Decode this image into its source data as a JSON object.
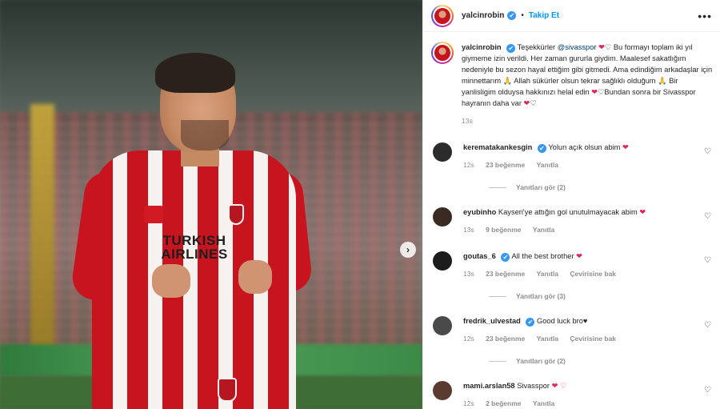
{
  "photo": {
    "sponsor_text": "TURKISH AIRLINES",
    "next_icon": "chevron-right-icon",
    "next_symbol": "›"
  },
  "header": {
    "username": "yalcinrobin",
    "verified_symbol": "✔",
    "separator": "•",
    "follow_label": "Takip Et",
    "more_symbol": "•••"
  },
  "caption": {
    "username": "yalcinrobin",
    "text_a": "Teşekkürler",
    "mention": "@sivasspor",
    "text_b": "Bu formayı toplam iki yıl giymeme izin verildi. Her zaman gururla giydim. Maalesef sakatlığım nedeniyle bu sezon hayal ettiğim gibi gitmedi. Ama edindiğim arkadaşlar için minnettarım 🙏 Allah sükürler olsun tekrar sağlıklı olduğum 🙏 Bir yanlisligim olduysa hakkınızı helal edin",
    "text_c": "Bundan sonra bir Sivasspor hayranın daha var",
    "time": "13s"
  },
  "comments": [
    {
      "username": "kerematakankesgin",
      "verified": true,
      "text": "Yolun açık olsun abim",
      "hearts": "❤",
      "time": "12s",
      "likes": "23 beğenme",
      "reply": "Yanıtla",
      "translate": "",
      "view_replies": "Yanıtları gör (2)",
      "avatar_color": "#2b2b2b"
    },
    {
      "username": "eyubinho",
      "verified": false,
      "text": "Kayseri'ye attığın gol unutulmayacak abim",
      "hearts": "❤",
      "time": "13s",
      "likes": "9 beğenme",
      "reply": "Yanıtla",
      "translate": "",
      "view_replies": "",
      "avatar_color": "#3a2a22"
    },
    {
      "username": "goutas_6",
      "verified": true,
      "text": "All the best brother",
      "hearts": "❤",
      "time": "13s",
      "likes": "23 beğenme",
      "reply": "Yanıtla",
      "translate": "Çevirisine bak",
      "view_replies": "Yanıtları gör (3)",
      "avatar_color": "#1c1c1c"
    },
    {
      "username": "fredrik_ulvestad",
      "verified": true,
      "text": "Good luck bro♥",
      "hearts": "",
      "time": "12s",
      "likes": "23 beğenme",
      "reply": "Yanıtla",
      "translate": "Çevirisine bak",
      "view_replies": "Yanıtları gör (2)",
      "avatar_color": "#4a4a4a"
    },
    {
      "username": "mami.arslan58",
      "verified": false,
      "text": "Sivasspor",
      "hearts": "❤ ♡",
      "time": "12s",
      "likes": "2 beğenme",
      "reply": "Yanıtla",
      "translate": "",
      "view_replies": "",
      "avatar_color": "#5a3b30"
    }
  ],
  "like_icon": "heart-outline-icon",
  "like_symbol": "♡",
  "colors": {
    "accent": "#0095f6",
    "heart": "#e0245e",
    "muted": "#8e8e8e",
    "verified": "#3897f0"
  }
}
